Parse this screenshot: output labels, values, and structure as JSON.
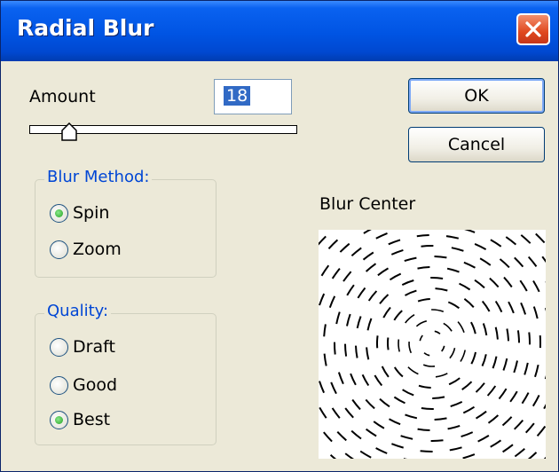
{
  "window": {
    "title": "Radial Blur",
    "close_icon": "close-icon"
  },
  "amount": {
    "label": "Amount",
    "value": "18",
    "min": 1,
    "max": 100
  },
  "buttons": {
    "ok": "OK",
    "cancel": "Cancel"
  },
  "blur_method": {
    "legend": "Blur Method:",
    "options": [
      {
        "label": "Spin",
        "checked": true
      },
      {
        "label": "Zoom",
        "checked": false
      }
    ]
  },
  "quality": {
    "legend": "Quality:",
    "options": [
      {
        "label": "Draft",
        "checked": false
      },
      {
        "label": "Good",
        "checked": false
      },
      {
        "label": "Best",
        "checked": true
      }
    ]
  },
  "blur_center": {
    "label": "Blur Center"
  },
  "colors": {
    "title_bar": "#0054e3",
    "dialog_bg": "#ece9d8",
    "legend_text": "#0046d5",
    "close_button": "#e0481f"
  }
}
